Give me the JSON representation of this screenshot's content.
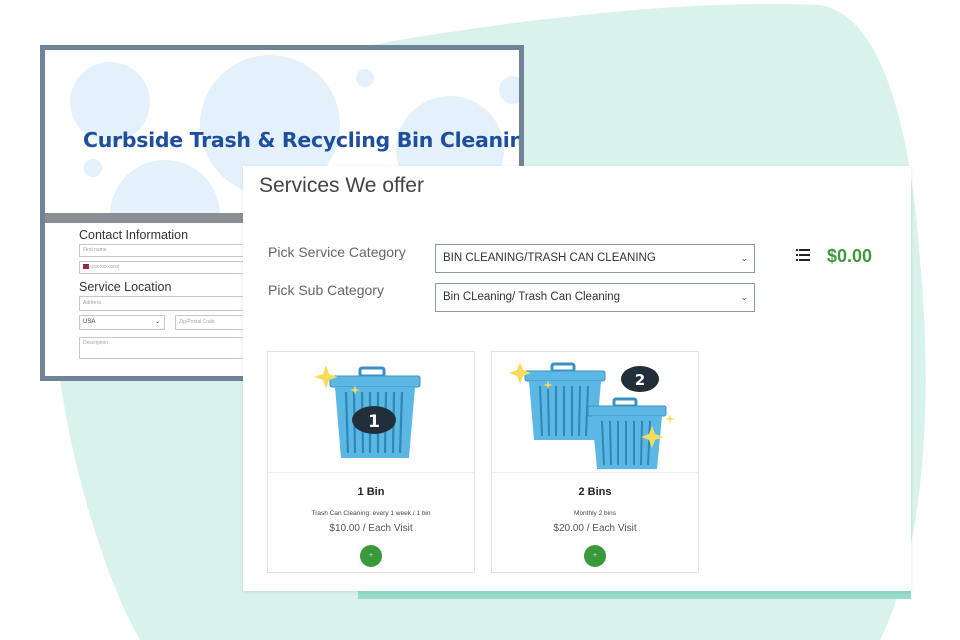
{
  "colors": {
    "brand_blue": "#1d4f9c",
    "accent_green": "#3c9a3c",
    "teal_background": "#d9f2ec",
    "bin_blue": "#5bb8e4",
    "sparkle_yellow": "#f7dc5c",
    "window_frame": "#6f8496"
  },
  "back_window": {
    "title": "Curbside Trash & Recycling Bin Cleaning",
    "contact_heading": "Contact Information",
    "first_name_placeholder": "First name",
    "phone_placeholder": "xxx-xxx-xxxx",
    "location_heading": "Service Location",
    "address_placeholder": "Address",
    "country_value": "USA",
    "zip_placeholder": "Zip/Postal Code",
    "description_placeholder": "Description"
  },
  "front_window": {
    "title": "Services We offer",
    "category_label": "Pick Service Category",
    "category_value": "BIN CLEANING/TRASH CAN CLEANING",
    "subcategory_label": "Pick Sub Category",
    "subcategory_value": "Bin CLeaning/ Trash Can Cleaning",
    "total": "$0.00",
    "list_icon": "list-icon",
    "cards": [
      {
        "badge": "1",
        "name": "1 Bin",
        "description": "Trash Can Cleaning: every 1 week / 1 bin",
        "price": "$10.00 / Each Visit",
        "add_label": "+"
      },
      {
        "badge": "2",
        "name": "2 Bins",
        "description": "Monthly 2 bins",
        "price": "$20.00 / Each Visit",
        "add_label": "+"
      }
    ]
  }
}
